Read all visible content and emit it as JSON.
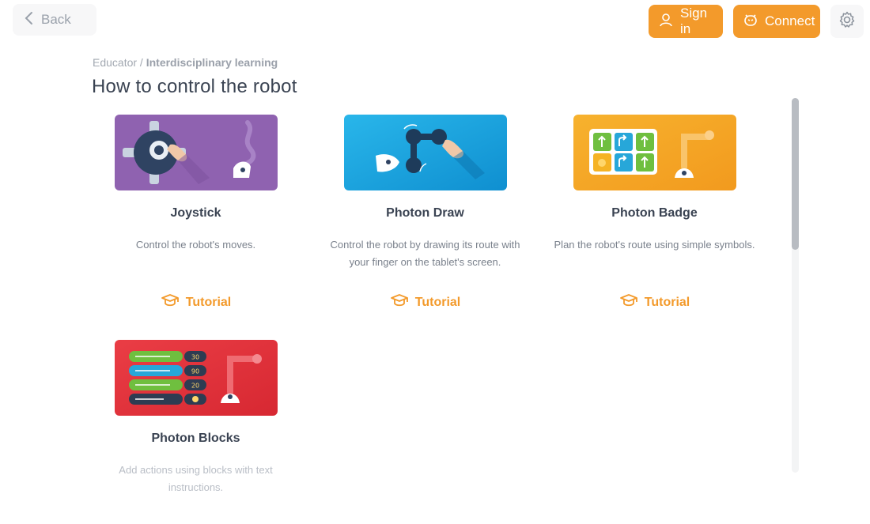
{
  "header": {
    "back_label": "Back",
    "signin_label": "Sign in",
    "connect_label": "Connect",
    "accent_color": "#f39a2b"
  },
  "breadcrumb": {
    "parent": "Educator",
    "separator": " / ",
    "current": "Interdisciplinary learning"
  },
  "page": {
    "title": "How to control the robot"
  },
  "cards": [
    {
      "title": "Joystick",
      "description": "Control the robot's moves.",
      "tutorial_label": "Tutorial",
      "thumb_color": "#8f62b0"
    },
    {
      "title": "Photon Draw",
      "description": "Control the robot by drawing its route with your finger on the tablet's screen.",
      "tutorial_label": "Tutorial",
      "thumb_color": "#1aa3df"
    },
    {
      "title": "Photon Badge",
      "description": "Plan the robot's route using simple symbols.",
      "tutorial_label": "Tutorial",
      "thumb_color": "#f5a623"
    },
    {
      "title": "Photon Blocks",
      "description": "Add actions using blocks with text instructions.",
      "thumb_color": "#e5363f",
      "block_values": [
        "30",
        "90",
        "20"
      ]
    }
  ],
  "icons": {
    "back": "chevron-left-icon",
    "signin": "user-icon",
    "connect": "robot-face-icon",
    "settings": "gear-icon",
    "tutorial": "graduation-cap-icon"
  }
}
